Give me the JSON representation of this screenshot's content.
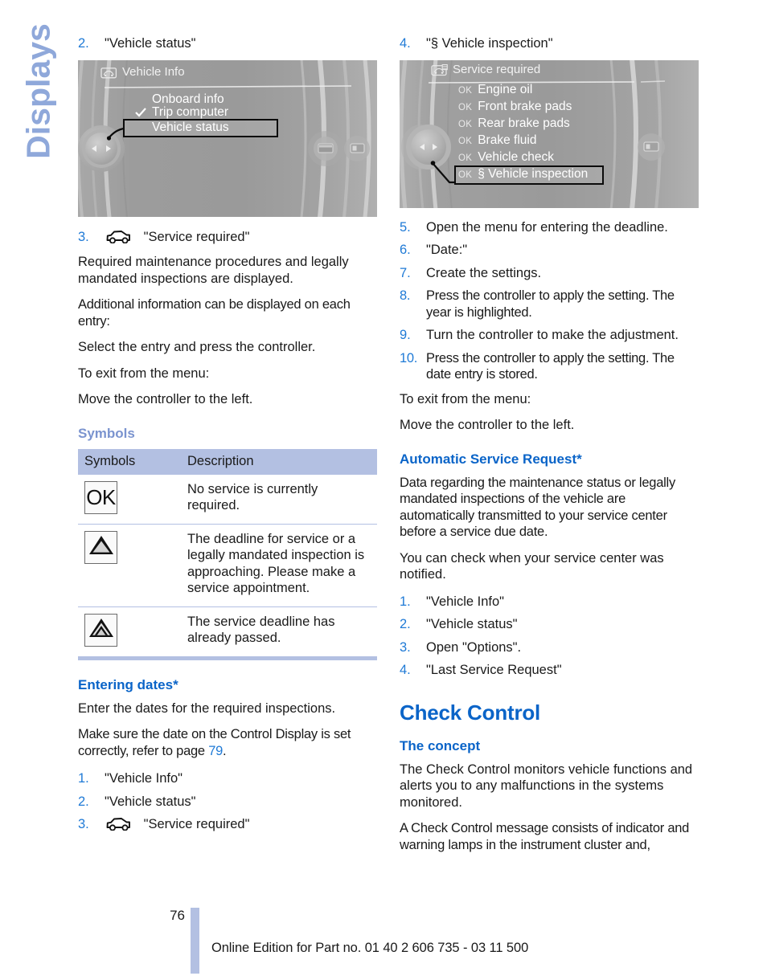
{
  "chapter_tab": {
    "label": "Displays"
  },
  "colors": {
    "accent_blue": "#0a64c8",
    "step_number_blue": "#1f7ad6",
    "tab_periwinkle": "#8fa8da",
    "table_header": "#b3c0e2"
  },
  "left_column": {
    "step2": {
      "num": "2.",
      "text": "\"Vehicle status\""
    },
    "display1": {
      "title": "Vehicle Info",
      "title_icon": "vehicle-info-icon",
      "items": [
        {
          "label": "Onboard info",
          "checked": false,
          "selected": false
        },
        {
          "label": "Trip computer",
          "checked": true,
          "selected": false
        },
        {
          "label": "Vehicle status",
          "checked": false,
          "selected": true
        }
      ],
      "right_icons": [
        "vehicle-side-icon",
        "display-icon"
      ]
    },
    "step3": {
      "num": "3.",
      "icon": "car-icon",
      "text": "\"Service required\""
    },
    "paras": [
      "Required maintenance procedures and legally mandated inspections are displayed.",
      "Additional information can be displayed on each entry:",
      "Select the entry and press the controller.",
      "To exit from the menu:",
      "Move the controller to the left."
    ],
    "symbols_heading": "Symbols",
    "symbols_table": {
      "headers": [
        "Symbols",
        "Description"
      ],
      "rows": [
        {
          "symbol": "OK",
          "symbol_type": "ok-glyph",
          "description": "No service is currently required."
        },
        {
          "symbol": "",
          "symbol_type": "triangle-glyph",
          "description": "The deadline for service or a legally mandated inspection is approaching. Please make a service appointment."
        },
        {
          "symbol": "",
          "symbol_type": "double-triangle-glyph",
          "description": "The service deadline has already passed."
        }
      ]
    },
    "entering_dates": {
      "heading": "Entering dates*",
      "para1": "Enter the dates for the required inspections.",
      "para2_before": "Make sure the date on the Control Display is set correctly, refer to page ",
      "para2_ref": "79",
      "para2_after": ".",
      "steps": [
        {
          "num": "1.",
          "text": "\"Vehicle Info\"",
          "icon": null
        },
        {
          "num": "2.",
          "text": "\"Vehicle status\"",
          "icon": null
        },
        {
          "num": "3.",
          "text": "\"Service required\"",
          "icon": "car-icon"
        }
      ]
    }
  },
  "right_column": {
    "step4": {
      "num": "4.",
      "text": "\"§ Vehicle inspection\""
    },
    "display2": {
      "title": "Service required",
      "title_icon": "service-required-icon",
      "items": [
        {
          "ok": "OK",
          "label": "Engine oil",
          "selected": false
        },
        {
          "ok": "OK",
          "label": "Front brake pads",
          "selected": false
        },
        {
          "ok": "OK",
          "label": "Rear brake pads",
          "selected": false
        },
        {
          "ok": "OK",
          "label": "Brake fluid",
          "selected": false
        },
        {
          "ok": "OK",
          "label": "Vehicle check",
          "selected": false
        },
        {
          "ok": "OK",
          "label": "§ Vehicle inspection",
          "selected": true
        }
      ],
      "right_icons": [
        "display-icon"
      ]
    },
    "steps": [
      {
        "num": "5.",
        "text": "Open the menu for entering the deadline."
      },
      {
        "num": "6.",
        "text": "\"Date:\""
      },
      {
        "num": "7.",
        "text": "Create the settings."
      },
      {
        "num": "8.",
        "text": "Press the controller to apply the setting. The year is highlighted."
      },
      {
        "num": "9.",
        "text": "Turn the controller to make the adjustment."
      },
      {
        "num": "10.",
        "text": "Press the controller to apply the setting. The date entry is stored."
      }
    ],
    "exit_line1": "To exit from the menu:",
    "exit_line2": "Move the controller to the left.",
    "automatic_service_request": {
      "heading": "Automatic Service Request*",
      "para1": "Data regarding the maintenance status or legally mandated inspections of the vehicle are automatically transmitted to your service center before a service due date.",
      "para2": "You can check when your service center was notified.",
      "steps": [
        {
          "num": "1.",
          "text": "\"Vehicle Info\""
        },
        {
          "num": "2.",
          "text": "\"Vehicle status\""
        },
        {
          "num": "3.",
          "text": "Open \"Options\"."
        },
        {
          "num": "4.",
          "text": "\"Last Service Request\""
        }
      ]
    },
    "check_control": {
      "heading": "Check Control",
      "sub_heading": "The concept",
      "para1": "The Check Control monitors vehicle functions and alerts you to any malfunctions in the systems monitored.",
      "para2": "A Check Control message consists of indicator and warning lamps in the instrument cluster and,"
    }
  },
  "footer": {
    "page_number": "76",
    "text": "Online Edition for Part no. 01 40 2 606 735 - 03 11 500"
  }
}
